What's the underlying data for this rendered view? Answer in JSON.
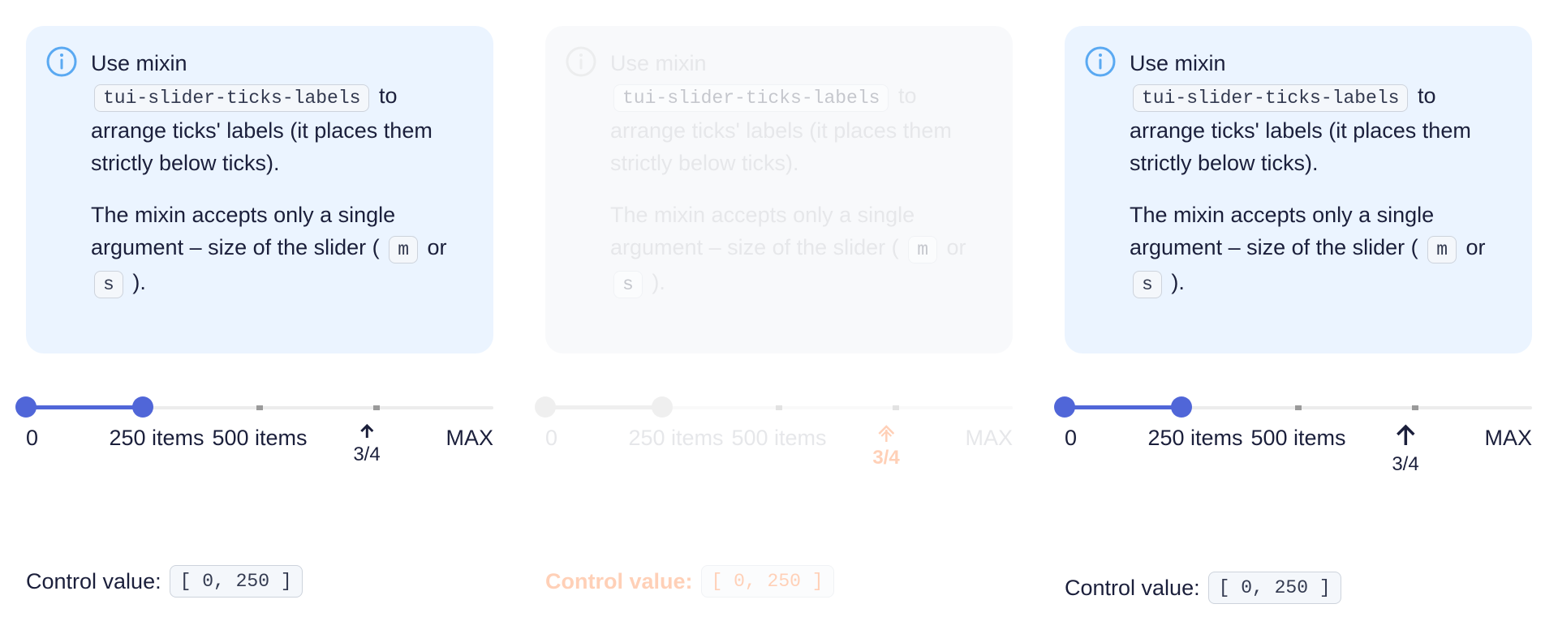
{
  "panels": [
    {
      "state": "active",
      "notification": {
        "icon": "info-circle-icon",
        "p1_before": "Use mixin",
        "p1_code": "tui-slider-ticks-labels",
        "p1_after": "to arrange ticks' labels (it places them strictly below ticks).",
        "p2_before": "The mixin accepts only a single argument – size of the slider (",
        "p2_code1": "m",
        "p2_mid": "or",
        "p2_code2": "s",
        "p2_after": ")."
      },
      "slider": {
        "min": 0,
        "max": 1000,
        "values": [
          0,
          250
        ],
        "ticks": [
          0,
          250,
          500,
          750,
          1000
        ]
      },
      "tick_labels": [
        "0",
        "250 items",
        "500 items",
        "MAX"
      ],
      "marker_fraction": "3/4",
      "control": {
        "label": "Control value:",
        "value": "[ 0, 250 ]"
      }
    },
    {
      "state": "disabled",
      "notification": {
        "icon": "info-circle-icon",
        "p1_before": "Use mixin",
        "p1_code": "tui-slider-ticks-labels",
        "p1_after": "to arrange ticks' labels (it places them strictly below ticks).",
        "p2_before": "The mixin accepts only a single argument – size of the slider (",
        "p2_code1": "m",
        "p2_mid": "or",
        "p2_code2": "s",
        "p2_after": ")."
      },
      "slider": {
        "min": 0,
        "max": 1000,
        "values": [
          0,
          250
        ],
        "ticks": [
          0,
          250,
          500,
          750,
          1000
        ]
      },
      "tick_labels": [
        "0",
        "250 items",
        "500 items",
        "MAX"
      ],
      "marker_fraction": "3/4",
      "control": {
        "label": "Control value:",
        "value": "[ 0, 250 ]"
      }
    },
    {
      "state": "active",
      "notification": {
        "icon": "info-circle-icon",
        "p1_before": "Use mixin",
        "p1_code": "tui-slider-ticks-labels",
        "p1_after": "to arrange ticks' labels (it places them strictly below ticks).",
        "p2_before": "The mixin accepts only a single argument – size of the slider (",
        "p2_code1": "m",
        "p2_mid": "or",
        "p2_code2": "s",
        "p2_after": ")."
      },
      "slider": {
        "min": 0,
        "max": 1000,
        "values": [
          0,
          250
        ],
        "ticks": [
          0,
          250,
          500,
          750,
          1000
        ]
      },
      "tick_labels": [
        "0",
        "250 items",
        "500 items",
        "MAX"
      ],
      "marker_fraction": "3/4",
      "control": {
        "label": "Control value:",
        "value": "[ 0, 250 ]"
      }
    }
  ],
  "colors": {
    "accent": "#5066d8",
    "notification_bg": "#ebf4ff",
    "info_icon": "#5aa9f2",
    "ghost_text": "#ff5a00"
  }
}
